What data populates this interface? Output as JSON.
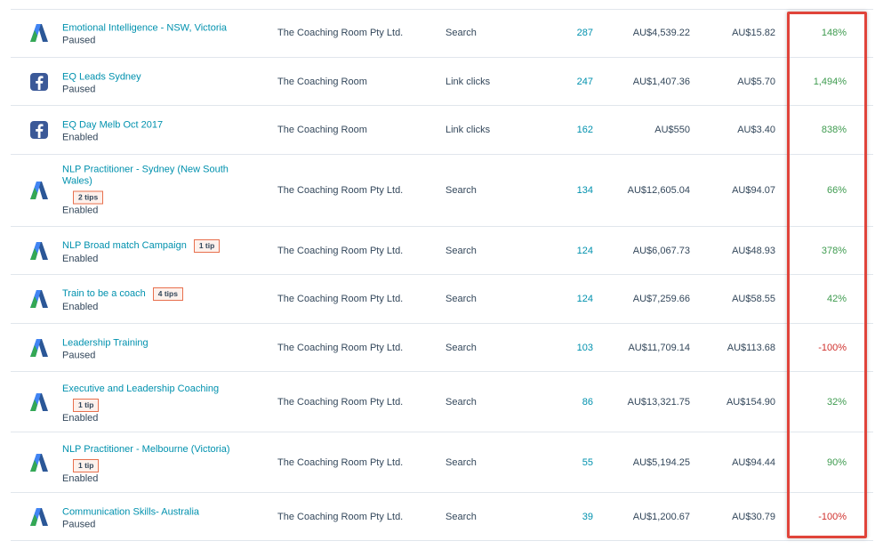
{
  "colors": {
    "link": "#0091ae",
    "positive": "#3e9b4f",
    "negative": "#d0312d",
    "highlight": "#e0443a"
  },
  "rows": [
    {
      "icon": "google-ads-icon",
      "name": "Emotional Intelligence - NSW, Victoria",
      "status": "Paused",
      "tips": "",
      "account": "The Coaching Room Pty Ltd.",
      "type": "Search",
      "clicks": "287",
      "spend": "AU$4,539.22",
      "cpc": "AU$15.82",
      "roi": "148%",
      "roi_sign": "pos"
    },
    {
      "icon": "facebook-icon",
      "name": "EQ Leads Sydney",
      "status": "Paused",
      "tips": "",
      "account": "The Coaching Room",
      "type": "Link clicks",
      "clicks": "247",
      "spend": "AU$1,407.36",
      "cpc": "AU$5.70",
      "roi": "1,494%",
      "roi_sign": "pos"
    },
    {
      "icon": "facebook-icon",
      "name": "EQ Day Melb Oct 2017",
      "status": "Enabled",
      "tips": "",
      "account": "The Coaching Room",
      "type": "Link clicks",
      "clicks": "162",
      "spend": "AU$550",
      "cpc": "AU$3.40",
      "roi": "838%",
      "roi_sign": "pos"
    },
    {
      "icon": "google-ads-icon",
      "name": "NLP Practitioner - Sydney (New South Wales)",
      "status": "Enabled",
      "tips": "2 tips",
      "account": "The Coaching Room Pty Ltd.",
      "type": "Search",
      "clicks": "134",
      "spend": "AU$12,605.04",
      "cpc": "AU$94.07",
      "roi": "66%",
      "roi_sign": "pos"
    },
    {
      "icon": "google-ads-icon",
      "name": "NLP Broad match Campaign",
      "status": "Enabled",
      "tips": "1 tip",
      "account": "The Coaching Room Pty Ltd.",
      "type": "Search",
      "clicks": "124",
      "spend": "AU$6,067.73",
      "cpc": "AU$48.93",
      "roi": "378%",
      "roi_sign": "pos"
    },
    {
      "icon": "google-ads-icon",
      "name": "Train to be a coach",
      "status": "Enabled",
      "tips": "4 tips",
      "account": "The Coaching Room Pty Ltd.",
      "type": "Search",
      "clicks": "124",
      "spend": "AU$7,259.66",
      "cpc": "AU$58.55",
      "roi": "42%",
      "roi_sign": "pos"
    },
    {
      "icon": "google-ads-icon",
      "name": "Leadership Training",
      "status": "Paused",
      "tips": "",
      "account": "The Coaching Room Pty Ltd.",
      "type": "Search",
      "clicks": "103",
      "spend": "AU$11,709.14",
      "cpc": "AU$113.68",
      "roi": "-100%",
      "roi_sign": "neg"
    },
    {
      "icon": "google-ads-icon",
      "name": "Executive and Leadership Coaching",
      "status": "Enabled",
      "tips": "1 tip",
      "account": "The Coaching Room Pty Ltd.",
      "type": "Search",
      "clicks": "86",
      "spend": "AU$13,321.75",
      "cpc": "AU$154.90",
      "roi": "32%",
      "roi_sign": "pos"
    },
    {
      "icon": "google-ads-icon",
      "name": "NLP Practitioner - Melbourne (Victoria)",
      "status": "Enabled",
      "tips": "1 tip",
      "account": "The Coaching Room Pty Ltd.",
      "type": "Search",
      "clicks": "55",
      "spend": "AU$5,194.25",
      "cpc": "AU$94.44",
      "roi": "90%",
      "roi_sign": "pos"
    },
    {
      "icon": "google-ads-icon",
      "name": "Communication Skills- Australia",
      "status": "Paused",
      "tips": "",
      "account": "The Coaching Room Pty Ltd.",
      "type": "Search",
      "clicks": "39",
      "spend": "AU$1,200.67",
      "cpc": "AU$30.79",
      "roi": "-100%",
      "roi_sign": "neg"
    }
  ]
}
